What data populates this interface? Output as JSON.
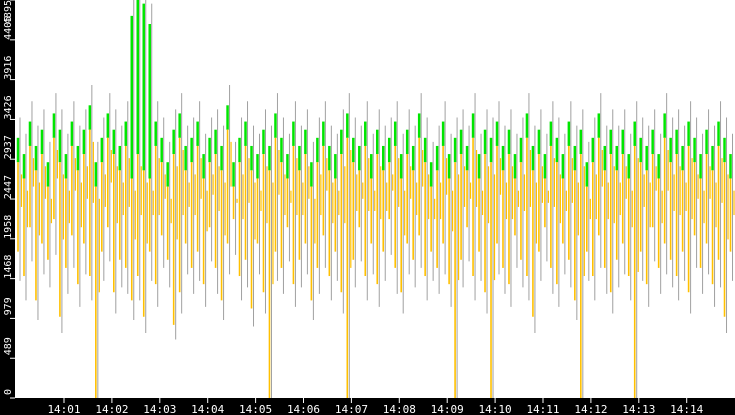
{
  "chart_data": {
    "type": "bar",
    "title": "",
    "xlabel": "",
    "ylabel": "",
    "ylim": [
      0,
      4895
    ],
    "yticks": [
      "0",
      "489",
      "979",
      "1468",
      "1958",
      "2447",
      "2937",
      "3426",
      "3916",
      "4405",
      "4895"
    ],
    "xticks": [
      "14:01",
      "14:02",
      "14:03",
      "14:04",
      "14:05",
      "14:06",
      "14:07",
      "14:08",
      "14:09",
      "14:10",
      "14:11",
      "14:12",
      "14:13",
      "14:14"
    ],
    "x_start": "14:00:00",
    "sample_interval_seconds": 7.5,
    "colors": {
      "low_range": "#ffc000",
      "high_range": "#00e600",
      "max": "#a0a0a0",
      "background": "#ffffff",
      "axis": "#000000",
      "axis_text": "#ffffff"
    },
    "series": [
      {
        "name": "low",
        "values": [
          1800,
          1500,
          2100,
          1200,
          1900,
          1700,
          2200,
          1000,
          1600,
          2000,
          1400,
          1900,
          1500,
          0,
          1800,
          2100,
          1300,
          1700,
          1600,
          1200,
          1500,
          1000,
          1800,
          1400,
          2000,
          1700,
          900,
          1300,
          1900,
          1600,
          1800,
          1400,
          2100,
          1600,
          1200,
          1900,
          2200,
          1500,
          1700,
          1100,
          1900,
          1300,
          0,
          1800,
          1600,
          2100,
          1400,
          1700,
          1900,
          1200,
          1600,
          2000,
          1500,
          1800,
          1300,
          0,
          1700,
          2100,
          1500,
          1900,
          1400,
          1800,
          2200,
          1600,
          1300,
          1900,
          1700,
          2000,
          1500,
          1800,
          1600,
          1900,
          1400,
          0,
          1700,
          2100,
          1500,
          1800,
          1300,
          0,
          1900,
          1600,
          1400,
          2000,
          1700,
          1500,
          1000,
          1800,
          2100,
          1600,
          1400,
          1900,
          1700,
          1200,
          0,
          1800,
          1500,
          2000,
          1600,
          1300,
          1700,
          1900,
          1500,
          0,
          1800,
          1400,
          2100,
          1600,
          1900,
          1700,
          1500,
          1800,
          1300,
          2000,
          1600,
          1900,
          1400,
          1700,
          1000,
          1800
        ]
      },
      {
        "name": "orange_high",
        "values": [
          2900,
          2700,
          3100,
          2800,
          3000,
          2600,
          3200,
          2900,
          2700,
          3100,
          2800,
          3000,
          3300,
          2600,
          2900,
          3200,
          3000,
          2800,
          3100,
          2700,
          3000,
          2800,
          2700,
          3100,
          2900,
          2600,
          3000,
          3200,
          2800,
          2900,
          3100,
          2700,
          2900,
          3000,
          2800,
          3300,
          2600,
          2900,
          3100,
          2800,
          2700,
          3000,
          2800,
          3200,
          2900,
          2700,
          3100,
          2800,
          3000,
          2600,
          2900,
          3100,
          2800,
          2700,
          3000,
          3200,
          2900,
          2800,
          3100,
          2700,
          3000,
          2800,
          2900,
          3100,
          2700,
          3000,
          2800,
          3200,
          2900,
          2600,
          2800,
          3100,
          2700,
          2900,
          3000,
          2800,
          3200,
          2700,
          3000,
          2900,
          3100,
          2800,
          3000,
          2700,
          2900,
          3200,
          2800,
          3000,
          2700,
          3100,
          2900,
          2700,
          3100,
          2800,
          3000,
          2600,
          2900,
          3200,
          2800,
          3000,
          2800,
          3000,
          2700,
          3100,
          2900,
          2800,
          3000,
          2700,
          3200,
          2900,
          3000,
          2800,
          3100,
          2900,
          2700,
          3000,
          2800,
          3100,
          2900,
          2700
        ]
      },
      {
        "name": "green_high",
        "values": [
          3200,
          3000,
          3400,
          3100,
          3300,
          2900,
          3500,
          3300,
          3000,
          3400,
          3100,
          3300,
          3600,
          2900,
          3200,
          3500,
          3300,
          3100,
          3400,
          4700,
          4895,
          4850,
          4600,
          3400,
          3200,
          2900,
          3300,
          3500,
          3100,
          3200,
          3400,
          3000,
          3200,
          3300,
          3100,
          3600,
          2900,
          3200,
          3400,
          3100,
          3000,
          3300,
          3100,
          3500,
          3200,
          3000,
          3400,
          3100,
          3300,
          2900,
          3200,
          3400,
          3100,
          3000,
          3300,
          3500,
          3200,
          3100,
          3400,
          3000,
          3300,
          3100,
          3200,
          3400,
          3000,
          3300,
          3100,
          3500,
          3200,
          2900,
          3100,
          3400,
          3000,
          3200,
          3300,
          3100,
          3500,
          3000,
          3300,
          3200,
          3400,
          3100,
          3300,
          3000,
          3200,
          3500,
          3100,
          3300,
          3000,
          3400,
          3200,
          3000,
          3400,
          3100,
          3300,
          2900,
          3200,
          3500,
          3100,
          3300,
          3100,
          3300,
          3000,
          3400,
          3200,
          3100,
          3300,
          3000,
          3500,
          3200,
          3300,
          3100,
          3400,
          3200,
          3000,
          3300,
          3100,
          3400,
          3200,
          3000
        ]
      }
    ]
  }
}
